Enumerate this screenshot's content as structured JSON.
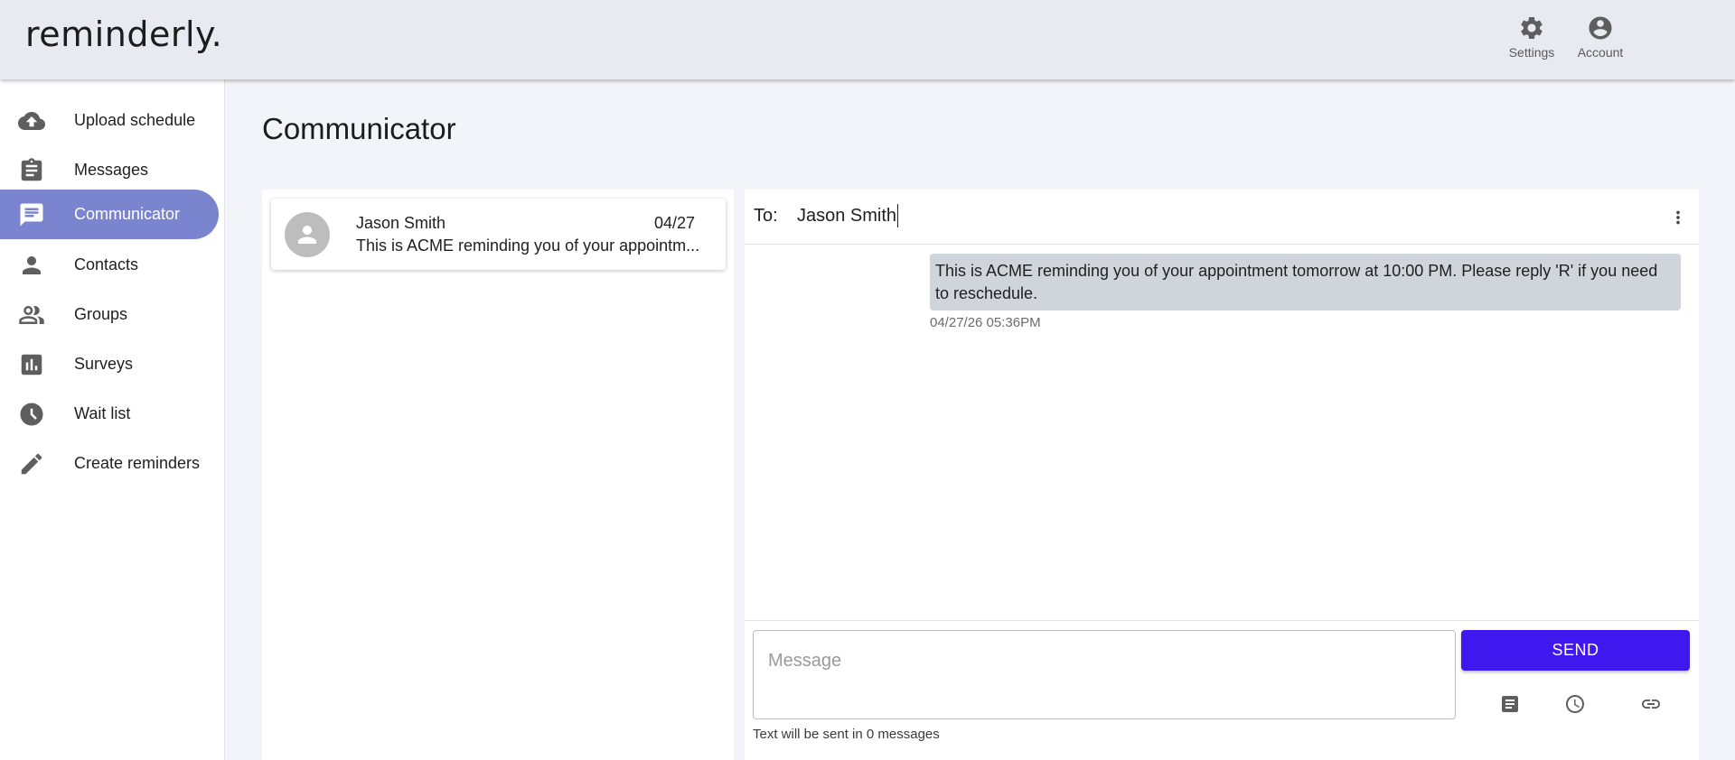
{
  "app": {
    "logo": "reminderly."
  },
  "header": {
    "settings_label": "Settings",
    "account_label": "Account",
    "icons": {
      "settings": "gear-icon",
      "account": "account-circle-icon"
    }
  },
  "sidebar": {
    "items": [
      {
        "label": "Upload schedule",
        "icon": "cloud-upload-icon",
        "active": false
      },
      {
        "label": "Messages",
        "icon": "clipboard-icon",
        "active": false
      },
      {
        "label": "Communicator",
        "icon": "chat-icon",
        "active": true
      },
      {
        "label": "Contacts",
        "icon": "person-icon",
        "active": false
      },
      {
        "label": "Groups",
        "icon": "people-icon",
        "active": false
      },
      {
        "label": "Surveys",
        "icon": "poll-icon",
        "active": false
      },
      {
        "label": "Wait list",
        "icon": "clock-icon",
        "active": false
      },
      {
        "label": "Create reminders",
        "icon": "pencil-icon",
        "active": false
      }
    ],
    "active_color": "#7a84cf"
  },
  "main": {
    "title": "Communicator",
    "conversations": [
      {
        "name": "Jason Smith",
        "date": "04/27",
        "preview": "This is ACME reminding you of your appointm..."
      }
    ],
    "chat": {
      "to_label": "To:",
      "to_value": "Jason Smith",
      "messages": [
        {
          "text": "This is ACME reminding you of your appointment tomorrow at 10:00 PM. Please reply 'R' if you need to reschedule.",
          "time": "04/27/26 05:36PM"
        }
      ],
      "compose": {
        "placeholder": "Message",
        "send_label": "SEND",
        "count_text": "Text will be sent in 0 messages",
        "tools": [
          "template-icon",
          "schedule-icon",
          "link-icon"
        ]
      },
      "send_color": "#3f18f0"
    }
  }
}
